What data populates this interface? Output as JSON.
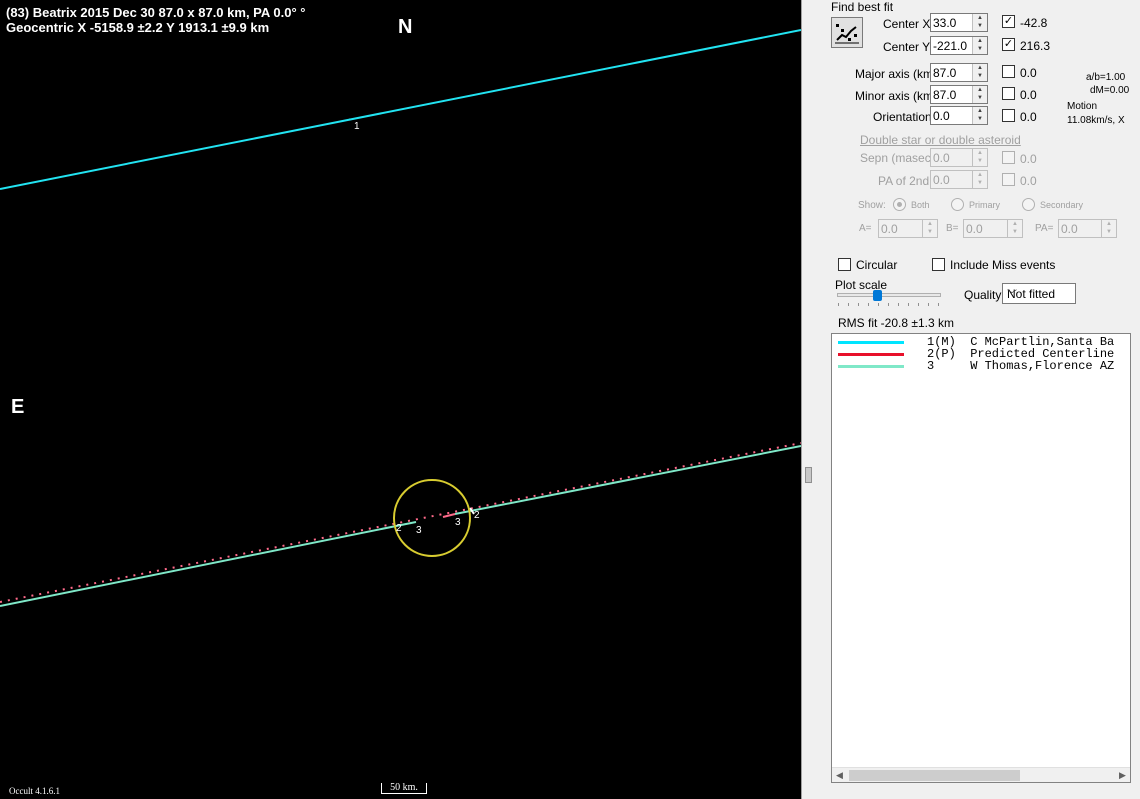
{
  "plot": {
    "header_line1": "(83) Beatrix  2015 Dec 30  87.0 x 87.0 km, PA 0.0° °",
    "header_line2": "Geocentric  X  -5158.9 ±2.2  Y 1913.1 ±9.9 km",
    "north_label": "N",
    "east_label": "E",
    "version": "Occult 4.1.6.1",
    "scale_label": "50 km.",
    "chord_labels": {
      "c1": "1",
      "c2a": "2",
      "c3a": "3",
      "c3b": "3",
      "c2b": "2"
    }
  },
  "colors": {
    "plot_background": "#000000",
    "chord_1": "#22e4f2",
    "chord_2_predicted": "#ff6a8a",
    "chord_3": "#7fe8c8",
    "asteroid_outline": "#d8cc30"
  },
  "panel": {
    "find_best_fit": "Find best fit",
    "fit_button_icon": "best-fit-icon",
    "center_x": {
      "label": "Center X",
      "value": "33.0",
      "fit_checked": true,
      "fit_value": "-42.8"
    },
    "center_y": {
      "label": "Center Y",
      "value": "-221.0",
      "fit_checked": true,
      "fit_value": "216.3"
    },
    "major_axis": {
      "label": "Major axis (km)",
      "value": "87.0",
      "fit_checked": false,
      "fit_value": "0.0"
    },
    "minor_axis": {
      "label": "Minor axis (km)",
      "value": "87.0",
      "fit_checked": false,
      "fit_value": "0.0"
    },
    "orientation": {
      "label": "Orientation",
      "value": "0.0",
      "fit_checked": false,
      "fit_value": "0.0"
    },
    "ab_ratio": "a/b=1.00",
    "dm": "dM=0.00",
    "motion_label": "Motion",
    "motion_value": "11.08km/s, X",
    "double_star_link": "Double star  or  double asteroid",
    "sepn": {
      "label": "Sepn (masec)",
      "value": "0.0",
      "fit_value": "0.0"
    },
    "pa_2nd": {
      "label": "PA of 2nd",
      "value": "0.0",
      "fit_value": "0.0"
    },
    "show_label": "Show:",
    "show_options": [
      "Both",
      "Primary",
      "Secondary"
    ],
    "a_label": "A=",
    "a_value": "0.0",
    "b_label": "B=",
    "b_value": "0.0",
    "pa_label": "PA=",
    "pa_value": "0.0",
    "circular_label": "Circular",
    "include_miss_label": "Include Miss events",
    "plot_scale_label": "Plot scale",
    "plot_scale_level": 0.38,
    "quality_label": "Quality",
    "quality_value": "Not fitted",
    "rms_fit": "RMS fit  -20.8 ±1.3 km"
  },
  "legend": [
    {
      "text": "1(M)  C McPartlin,Santa Ba",
      "color": "#00e5ff"
    },
    {
      "text": "2(P)  Predicted Centerline",
      "color": "#e8102a"
    },
    {
      "text": "3     W Thomas,Florence AZ",
      "color": "#7fe8c8"
    }
  ]
}
